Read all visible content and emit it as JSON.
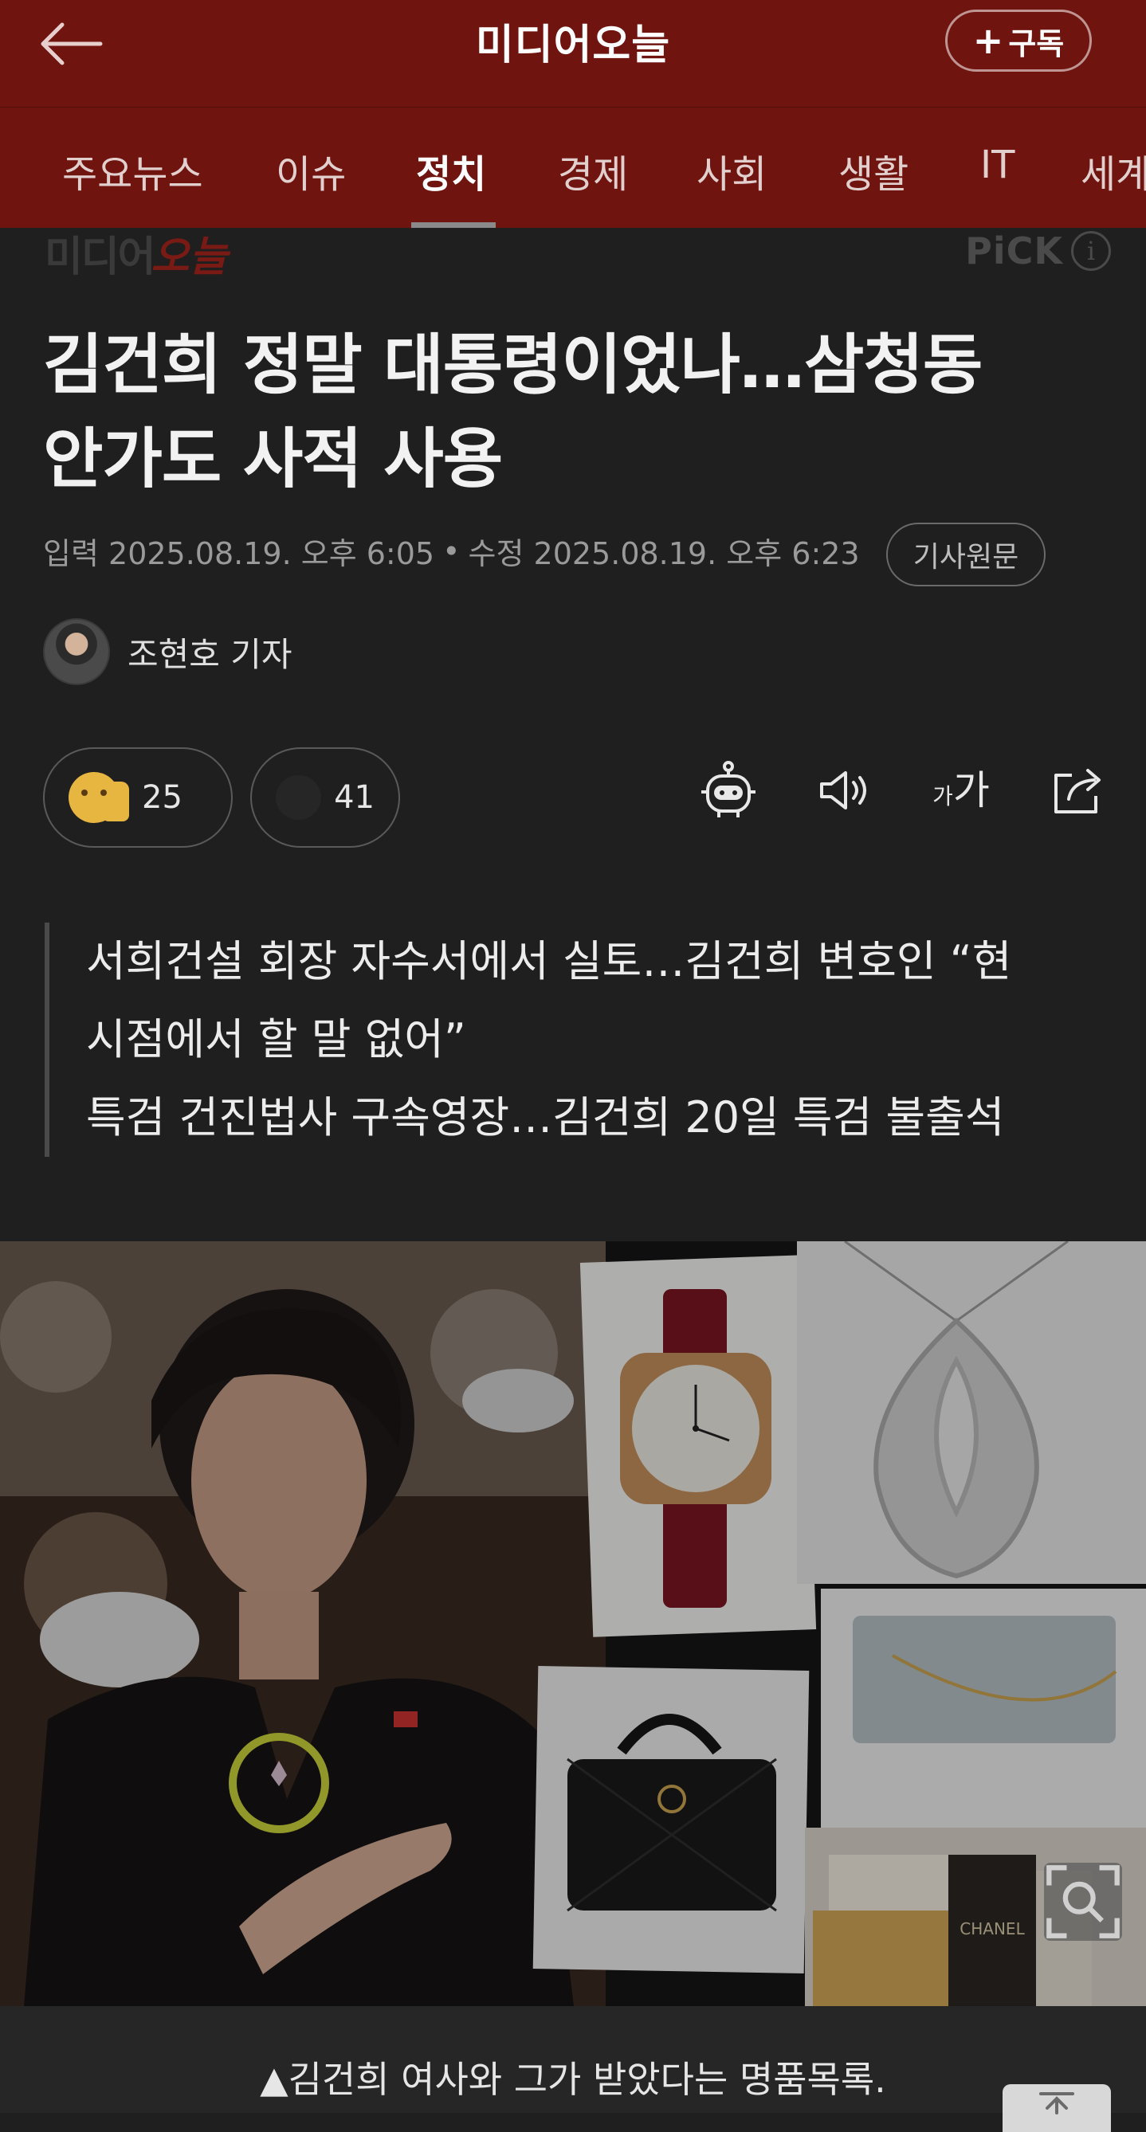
{
  "header": {
    "back_icon": "arrow-left-icon",
    "title": "미디어오늘",
    "subscribe_label": "구독",
    "subscribe_icon": "plus-icon",
    "bg_color": "#6f140f"
  },
  "tabs": [
    {
      "label": "주요뉴스",
      "active": false
    },
    {
      "label": "이슈",
      "active": false
    },
    {
      "label": "정치",
      "active": true
    },
    {
      "label": "경제",
      "active": false
    },
    {
      "label": "사회",
      "active": false
    },
    {
      "label": "생활",
      "active": false
    },
    {
      "label": "IT",
      "active": false
    },
    {
      "label": "세계",
      "active": false
    }
  ],
  "source": {
    "logo_main": "미디어",
    "logo_accent": "오늘",
    "pick_label": "PiCK",
    "pick_info_icon": "info-icon"
  },
  "article": {
    "headline_line1": "김건희 정말 대통령이었나…삼청동",
    "headline_line2": "안가도 사적 사용",
    "input_label": "입력",
    "input_time": "2025.08.19. 오후 6:05",
    "separator": "•",
    "edit_label": "수정",
    "edit_time": "2025.08.19. 오후 6:23",
    "original_button": "기사원문",
    "author": "조현호 기자"
  },
  "reactions": {
    "like_count": "25",
    "comment_count": "41"
  },
  "tools": {
    "summary_icon": "robot-icon",
    "tts_icon": "speaker-icon",
    "font_small": "가",
    "font_big": "가",
    "share_icon": "share-icon"
  },
  "summary": {
    "line1": "서희건설 회장 자수서에서 실토…김건희 변호인 “현",
    "line2": "시점에서 할 말 없어”",
    "line3": "특검 건진법사 구속영장…김건희 20일 특검 불출석"
  },
  "photo": {
    "zoom_icon": "zoom-icon",
    "caption": "▲김건희 여사와 그가 받았다는 명품목록."
  }
}
